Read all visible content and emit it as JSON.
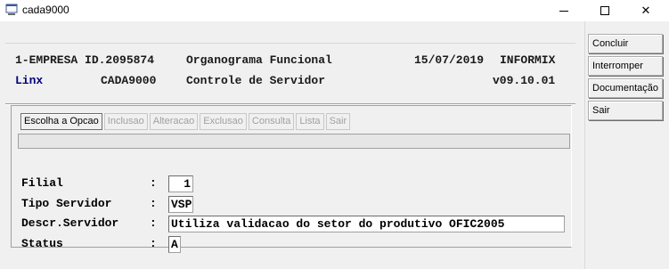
{
  "window": {
    "title": "cada9000",
    "icon": "app-window-icon",
    "controls": {
      "minimize": "minimize-icon",
      "maximize": "maximize-icon",
      "close": "close-icon"
    }
  },
  "header": {
    "row1": {
      "left": "1-EMPRESA ID.2095874",
      "center": "Organograma Funcional",
      "date": "15/07/2019",
      "db": "INFORMIX"
    },
    "row2": {
      "left": "Linx",
      "program": "CADA9000",
      "center": "Controle de Servidor",
      "version": "v09.10.01"
    }
  },
  "tabs": [
    {
      "label": "Escolha a Opcao",
      "active": true
    },
    {
      "label": "Inclusao",
      "active": false
    },
    {
      "label": "Alteracao",
      "active": false
    },
    {
      "label": "Exclusao",
      "active": false
    },
    {
      "label": "Consulta",
      "active": false
    },
    {
      "label": "Lista",
      "active": false
    },
    {
      "label": "Sair",
      "active": false
    }
  ],
  "message": "",
  "fields": {
    "filial": {
      "label": "Filial",
      "colon": ":",
      "value": "1"
    },
    "tipo_servidor": {
      "label": "Tipo Servidor",
      "colon": ":",
      "value": "VSP"
    },
    "descr_servidor": {
      "label": "Descr.Servidor",
      "colon": ":",
      "value": "Utiliza validacao do setor do produtivo OFIC2005"
    },
    "status": {
      "label": "Status",
      "colon": ":",
      "value": "A"
    }
  },
  "side_buttons": {
    "concluir": "Concluir",
    "interromper": "Interromper",
    "documentacao": "Documentação",
    "sair": "Sair"
  }
}
